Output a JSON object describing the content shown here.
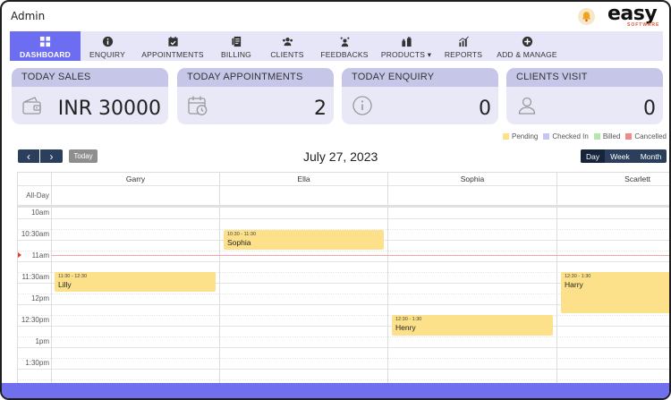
{
  "app": {
    "title": "Admin",
    "logo_text": "easy",
    "logo_sub": "SOFTWARE"
  },
  "nav": [
    {
      "label": "DASHBOARD",
      "icon": "dashboard-icon",
      "active": true
    },
    {
      "label": "ENQUIRY",
      "icon": "info-icon"
    },
    {
      "label": "APPOINTMENTS",
      "icon": "calendar-check-icon"
    },
    {
      "label": "BILLING",
      "icon": "billing-icon"
    },
    {
      "label": "CLIENTS",
      "icon": "users-icon"
    },
    {
      "label": "FEEDBACKS",
      "icon": "sparkle-person-icon"
    },
    {
      "label": "PRODUCTS ▾",
      "icon": "products-icon"
    },
    {
      "label": "REPORTS",
      "icon": "bar-chart-icon"
    },
    {
      "label": "ADD & MANAGE",
      "icon": "plus-circle-icon"
    }
  ],
  "cards": [
    {
      "title": "TODAY SALES",
      "value": "INR 30000",
      "icon": "wallet-icon"
    },
    {
      "title": "TODAY APPOINTMENTS",
      "value": "2",
      "icon": "calendar-clock-icon"
    },
    {
      "title": "TODAY ENQUIRY",
      "value": "0",
      "icon": "info-circle-icon"
    },
    {
      "title": "CLIENTS VISIT",
      "value": "0",
      "icon": "user-outline-icon"
    }
  ],
  "legend": [
    {
      "label": "Pending",
      "color": "#fce18a"
    },
    {
      "label": "Checked In",
      "color": "#c7c6f2"
    },
    {
      "label": "Billed",
      "color": "#b6e6b0"
    },
    {
      "label": "Cancelled",
      "color": "#f08a8a"
    }
  ],
  "calendar": {
    "title": "July 27, 2023",
    "prev": "‹",
    "next": "›",
    "today": "Today",
    "views": [
      "Day",
      "Week",
      "Month"
    ],
    "selected_view": "Day",
    "all_day": "All-Day",
    "staff": [
      "Garry",
      "Ella",
      "Sophia",
      "Scarlett"
    ],
    "times": [
      "10am",
      "10:30am",
      "11am",
      "11:30am",
      "12pm",
      "12:30pm",
      "1pm",
      "1:30pm"
    ],
    "events": [
      {
        "time": "10:30 - 11:30",
        "client": "Sophia",
        "staff": "Ella"
      },
      {
        "time": "11:30 - 12:30",
        "client": "Lilly",
        "staff": "Garry"
      },
      {
        "time": "12:30 - 1:30",
        "client": "Harry",
        "staff": "Scarlett"
      },
      {
        "time": "12:30 - 1:30",
        "client": "Henry",
        "staff": "Sophia"
      }
    ]
  }
}
